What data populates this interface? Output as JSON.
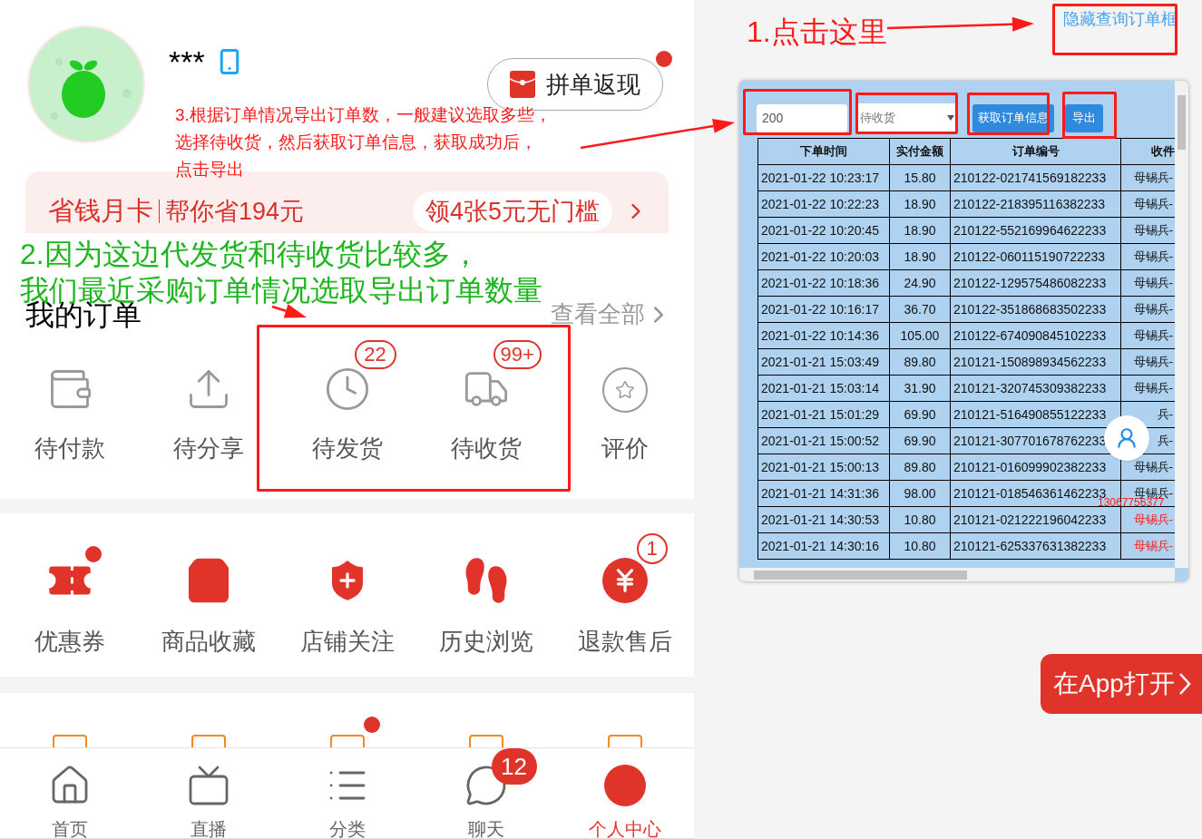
{
  "profile": {
    "name": "***",
    "group_cashback": {
      "label": "拼单返现",
      "dot": true
    }
  },
  "banner": {
    "title": "省钱月卡",
    "subtitle": "帮你省194元",
    "offer": "领4张5元无门槛"
  },
  "orders": {
    "title": "我的订单",
    "view_all": "查看全部",
    "items": [
      {
        "label": "待付款"
      },
      {
        "label": "待分享"
      },
      {
        "label": "待发货",
        "badge": "22"
      },
      {
        "label": "待收货",
        "badge": "99+"
      },
      {
        "label": "评价"
      }
    ]
  },
  "tools": [
    {
      "label": "优惠券",
      "dot": true
    },
    {
      "label": "商品收藏",
      "dot": false
    },
    {
      "label": "店铺关注",
      "dot": false
    },
    {
      "label": "历史浏览",
      "dot": false
    },
    {
      "label": "退款售后",
      "dot": false,
      "badge": "1"
    }
  ],
  "more_services": [
    {
      "dot": false
    },
    {
      "dot": false
    },
    {
      "dot": true
    },
    {
      "dot": false
    },
    {
      "dot": false
    }
  ],
  "bottom_nav": [
    {
      "label": "首页",
      "selected": false
    },
    {
      "label": "直播",
      "selected": false
    },
    {
      "label": "分类",
      "selected": false
    },
    {
      "label": "聊天",
      "selected": false,
      "badge": "12"
    },
    {
      "label": "个人中心",
      "selected": true
    }
  ],
  "query_panel": {
    "toggle_link": "隐藏查询订单框",
    "count": "200",
    "status": "待收货",
    "fetch_button": "获取订单信息",
    "export_button": "导出",
    "columns": [
      "下单时间",
      "实付金额",
      "订单编号",
      "收件"
    ],
    "rows": [
      {
        "time": "2021-01-22 10:23:17",
        "amount": "15.80",
        "order_no": "210122-021741569182233",
        "recipient": "母锡兵-",
        "flagged": false
      },
      {
        "time": "2021-01-22 10:22:23",
        "amount": "18.90",
        "order_no": "210122-218395116382233",
        "recipient": "母锡兵-",
        "flagged": false
      },
      {
        "time": "2021-01-22 10:20:45",
        "amount": "18.90",
        "order_no": "210122-552169964622233",
        "recipient": "母锡兵-",
        "flagged": false
      },
      {
        "time": "2021-01-22 10:20:03",
        "amount": "18.90",
        "order_no": "210122-060115190722233",
        "recipient": "母锡兵-",
        "flagged": false
      },
      {
        "time": "2021-01-22 10:18:36",
        "amount": "24.90",
        "order_no": "210122-129575486082233",
        "recipient": "母锡兵-",
        "flagged": false
      },
      {
        "time": "2021-01-22 10:16:17",
        "amount": "36.70",
        "order_no": "210122-351868683502233",
        "recipient": "母锡兵-",
        "flagged": false
      },
      {
        "time": "2021-01-22 10:14:36",
        "amount": "105.00",
        "order_no": "210122-674090845102233",
        "recipient": "母锡兵-",
        "flagged": false
      },
      {
        "time": "2021-01-21 15:03:49",
        "amount": "89.80",
        "order_no": "210121-150898934562233",
        "recipient": "母锡兵-",
        "flagged": false
      },
      {
        "time": "2021-01-21 15:03:14",
        "amount": "31.90",
        "order_no": "210121-320745309382233",
        "recipient": "母锡兵-",
        "flagged": false
      },
      {
        "time": "2021-01-21 15:01:29",
        "amount": "69.90",
        "order_no": "210121-516490855122233",
        "recipient": "兵-",
        "flagged": false
      },
      {
        "time": "2021-01-21 15:00:52",
        "amount": "69.90",
        "order_no": "210121-307701678762233",
        "recipient": "兵-",
        "flagged": false
      },
      {
        "time": "2021-01-21 15:00:13",
        "amount": "89.80",
        "order_no": "210121-016099902382233",
        "recipient": "母锡兵-",
        "flagged": false
      },
      {
        "time": "2021-01-21 14:31:36",
        "amount": "98.00",
        "order_no": "210121-018546361462233",
        "recipient": "母锡兵-",
        "flagged": false
      },
      {
        "time": "2021-01-21 14:30:53",
        "amount": "10.80",
        "order_no": "210121-021222196042233",
        "recipient": "母锡兵-",
        "flagged": true
      },
      {
        "time": "2021-01-21 14:30:16",
        "amount": "10.80",
        "order_no": "210121-625337631382233",
        "recipient": "母锡兵-",
        "flagged": true
      }
    ]
  },
  "contact_phone": "13067756377",
  "open_in_app": "在App打开",
  "annotations": {
    "step1": "1.点击这里",
    "step2": [
      "2.因为这边代发货和待收货比较多，",
      "我们最近采购订单情况选取导出订单数量"
    ],
    "step3": [
      "3.根据订单情况导出订单数，一般建议选取多些，",
      "选择待收货，然后获取订单信息，获取成功后，",
      "点击导出"
    ]
  }
}
